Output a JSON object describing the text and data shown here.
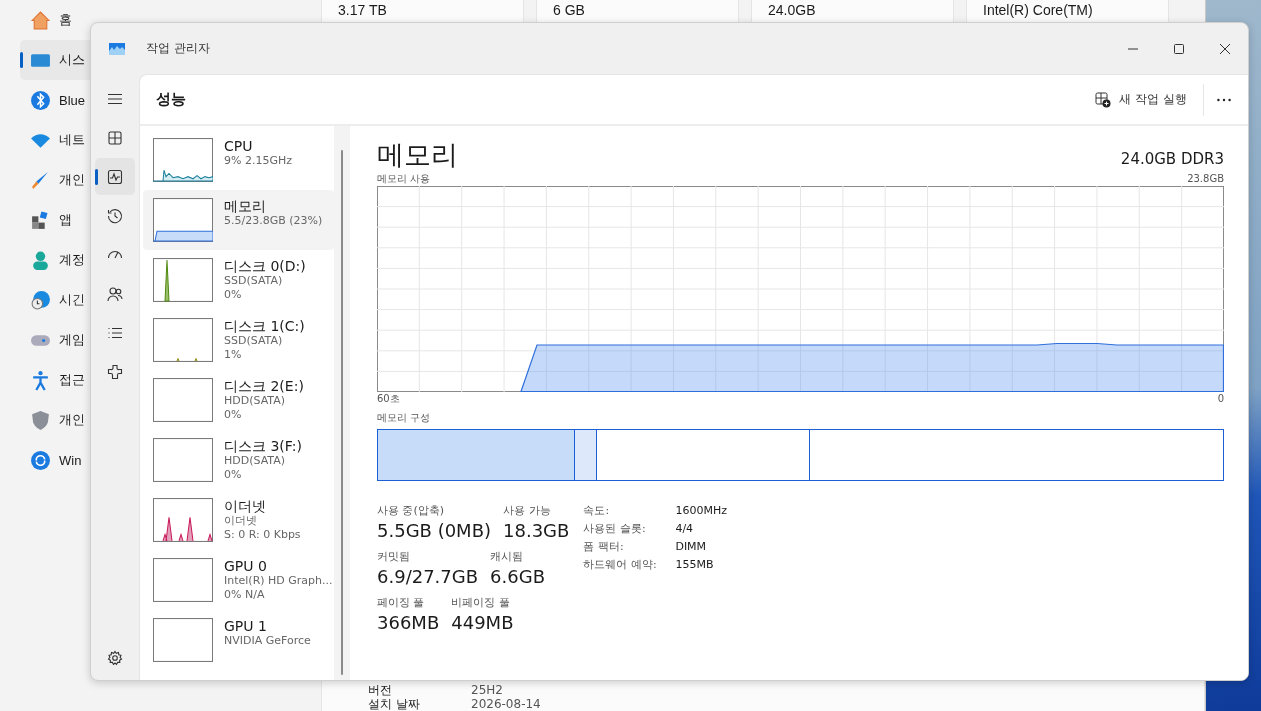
{
  "settings_window": {
    "nav_items": [
      {
        "label": "홈",
        "kind": "home",
        "selected": false
      },
      {
        "label": "시스",
        "kind": "system",
        "selected": true
      },
      {
        "label": "Blue",
        "kind": "bluetooth",
        "selected": false
      },
      {
        "label": "네트",
        "kind": "network",
        "selected": false
      },
      {
        "label": "개인",
        "kind": "brush",
        "selected": false
      },
      {
        "label": "앱",
        "kind": "apps",
        "selected": false
      },
      {
        "label": "계정",
        "kind": "account",
        "selected": false
      },
      {
        "label": "시긴",
        "kind": "time",
        "selected": false
      },
      {
        "label": "게임",
        "kind": "game",
        "selected": false
      },
      {
        "label": "접근",
        "kind": "access",
        "selected": false
      },
      {
        "label": "개인",
        "kind": "shield",
        "selected": false
      },
      {
        "label": "Win",
        "kind": "update",
        "selected": false
      }
    ],
    "top_values": [
      "3.17 TB",
      "6 GB",
      "24.0GB",
      "Intel(R) Core(TM)"
    ],
    "rows": [
      {
        "label": "버전",
        "value": "25H2"
      },
      {
        "label": "설치 날짜",
        "value": "2026-08-14"
      }
    ]
  },
  "window": {
    "title": "작업 관리자"
  },
  "nav": [
    {
      "kind": "menu",
      "selected": false
    },
    {
      "kind": "processes",
      "selected": false
    },
    {
      "kind": "performance",
      "selected": true
    },
    {
      "kind": "history",
      "selected": false
    },
    {
      "kind": "startup",
      "selected": false
    },
    {
      "kind": "users",
      "selected": false
    },
    {
      "kind": "details",
      "selected": false
    },
    {
      "kind": "services",
      "selected": false
    }
  ],
  "page_title": "성능",
  "toolbar": {
    "run_task": "새 작업 실행"
  },
  "resources": [
    {
      "name": "CPU",
      "lines": [
        "9% 2.15GHz"
      ],
      "kind": "cpu",
      "selected": false
    },
    {
      "name": "메모리",
      "lines": [
        "5.5/23.8GB (23%)"
      ],
      "kind": "memory",
      "selected": true
    },
    {
      "name": "디스크 0(D:)",
      "lines": [
        "SSD(SATA)",
        "0%"
      ],
      "kind": "disk_spike",
      "selected": false
    },
    {
      "name": "디스크 1(C:)",
      "lines": [
        "SSD(SATA)",
        "1%"
      ],
      "kind": "disk_low",
      "selected": false
    },
    {
      "name": "디스크 2(E:)",
      "lines": [
        "HDD(SATA)",
        "0%"
      ],
      "kind": "empty",
      "selected": false
    },
    {
      "name": "디스크 3(F:)",
      "lines": [
        "HDD(SATA)",
        "0%"
      ],
      "kind": "empty",
      "selected": false
    },
    {
      "name": "이더넷",
      "lines": [
        "이더넷",
        "S: 0 R: 0 Kbps"
      ],
      "kind": "network",
      "selected": false
    },
    {
      "name": "GPU 0",
      "lines": [
        "Intel(R) HD Graph...",
        "0% N/A"
      ],
      "kind": "empty",
      "selected": false
    },
    {
      "name": "GPU 1",
      "lines": [
        "NVIDIA GeForce"
      ],
      "kind": "empty",
      "selected": false
    }
  ],
  "detail": {
    "title": "메모리",
    "spec": "24.0GB DDR3",
    "usage_label": "메모리 사용",
    "usage_max": "23.8GB",
    "time_start": "60초",
    "time_end": "0",
    "composition_label": "메모리 구성",
    "stat_rows": [
      [
        {
          "label": "사용 중(압축)",
          "value": "5.5GB (0MB)"
        },
        {
          "label": "사용 가능",
          "value": "18.3GB"
        }
      ],
      [
        {
          "label": "커밋됨",
          "value": "6.9/27.7GB"
        },
        {
          "label": "캐시됨",
          "value": "6.6GB"
        }
      ],
      [
        {
          "label": "페이징 풀",
          "value": "366MB"
        },
        {
          "label": "비페이징 풀",
          "value": "449MB"
        }
      ]
    ],
    "properties": [
      {
        "label": "속도:",
        "value": "1600MHz"
      },
      {
        "label": "사용된 슬롯:",
        "value": "4/4"
      },
      {
        "label": "폼 팩터:",
        "value": "DIMM"
      },
      {
        "label": "하드웨어 예약:",
        "value": "155MB"
      }
    ]
  }
}
